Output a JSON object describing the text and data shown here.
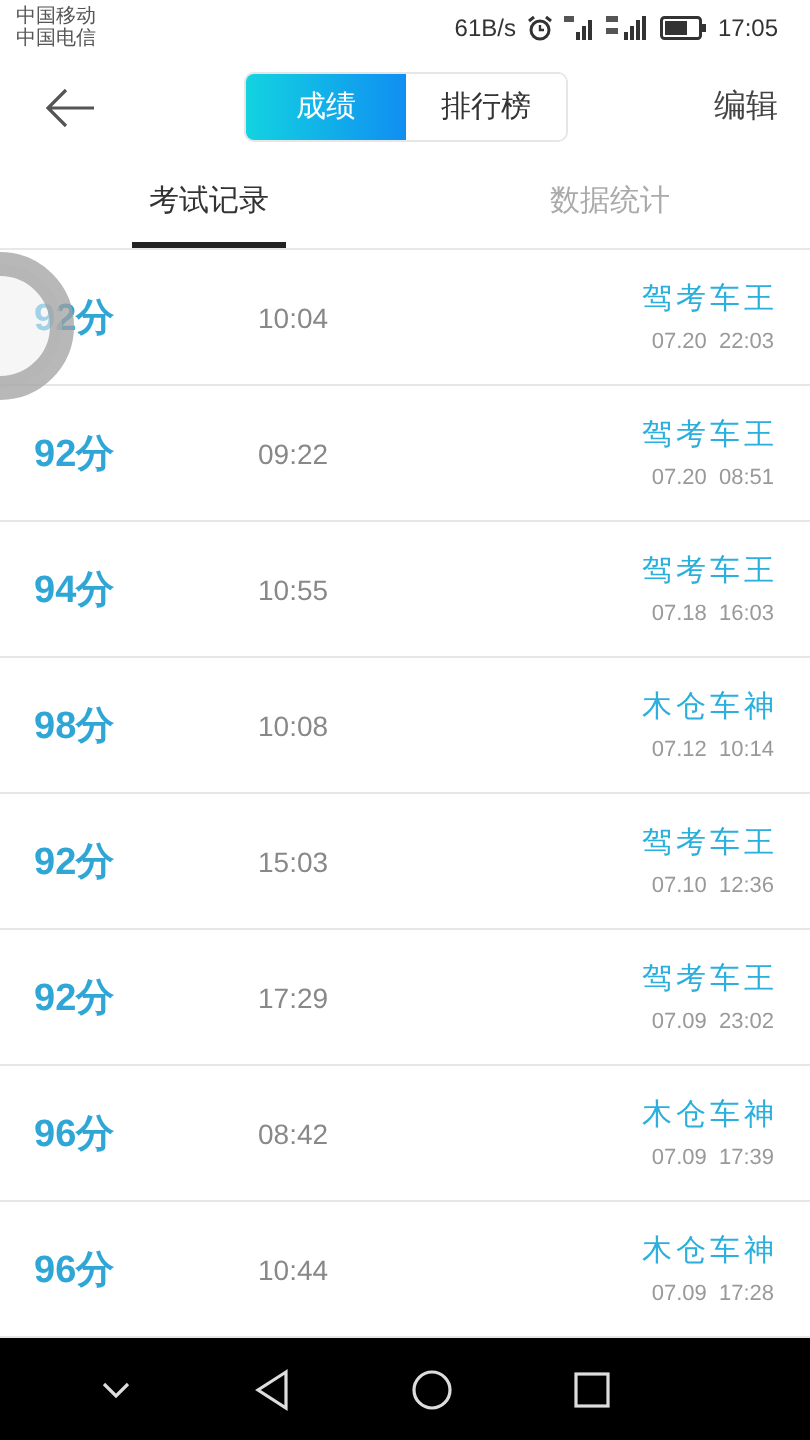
{
  "status_bar": {
    "carriers": [
      "中国移动",
      "中国电信"
    ],
    "speed": "61B/s",
    "time": "17:05"
  },
  "header": {
    "segments": [
      {
        "label": "成绩",
        "selected": true
      },
      {
        "label": "排行榜",
        "selected": false
      }
    ],
    "action": "编辑"
  },
  "tabs": [
    {
      "label": "考试记录",
      "selected": true
    },
    {
      "label": "数据统计",
      "selected": false
    }
  ],
  "records": [
    {
      "score": "92分",
      "duration": "10:04",
      "title": "驾考车王",
      "datetime": "07.20  22:03"
    },
    {
      "score": "92分",
      "duration": "09:22",
      "title": "驾考车王",
      "datetime": "07.20  08:51"
    },
    {
      "score": "94分",
      "duration": "10:55",
      "title": "驾考车王",
      "datetime": "07.18  16:03"
    },
    {
      "score": "98分",
      "duration": "10:08",
      "title": "木仓车神",
      "datetime": "07.12  10:14"
    },
    {
      "score": "92分",
      "duration": "15:03",
      "title": "驾考车王",
      "datetime": "07.10  12:36"
    },
    {
      "score": "92分",
      "duration": "17:29",
      "title": "驾考车王",
      "datetime": "07.09  23:02"
    },
    {
      "score": "96分",
      "duration": "08:42",
      "title": "木仓车神",
      "datetime": "07.09  17:39"
    },
    {
      "score": "96分",
      "duration": "10:44",
      "title": "木仓车神",
      "datetime": "07.09  17:28"
    }
  ]
}
